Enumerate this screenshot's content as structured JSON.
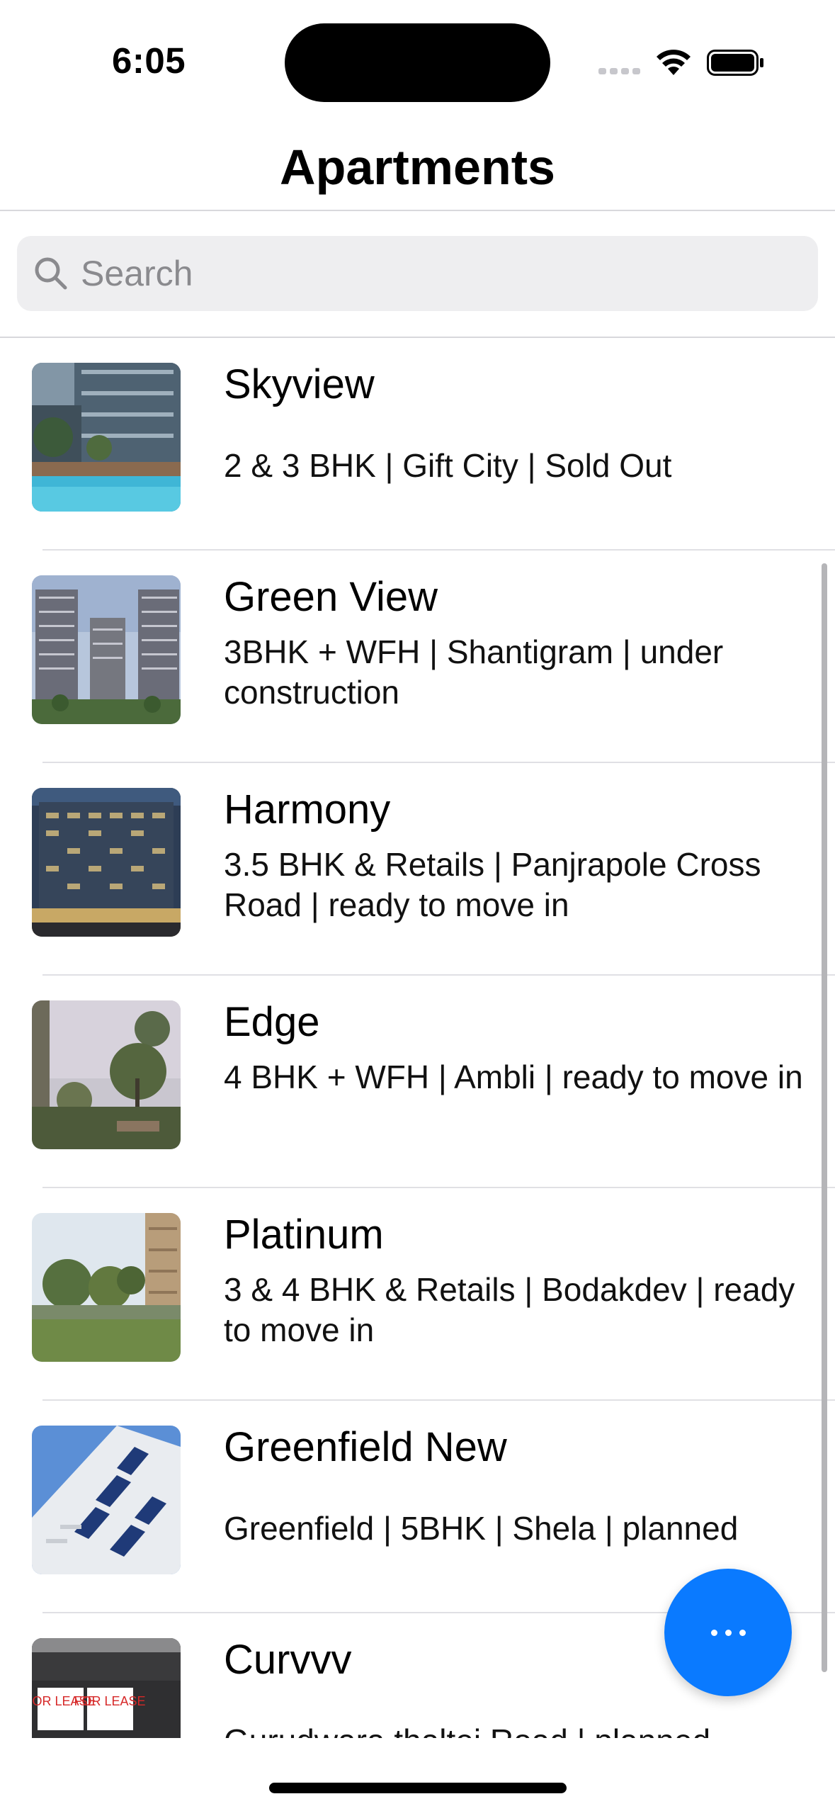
{
  "status_bar": {
    "time": "6:05"
  },
  "nav": {
    "title": "Apartments"
  },
  "search": {
    "placeholder": "Search",
    "value": ""
  },
  "apartments": [
    {
      "name": "Skyview",
      "details": "2 & 3 BHK | Gift City | Sold Out"
    },
    {
      "name": "Green View",
      "details": "3BHK + WFH | Shantigram | under construction"
    },
    {
      "name": "Harmony",
      "details": "3.5 BHK & Retails | Panjrapole Cross Road | ready to move in"
    },
    {
      "name": "Edge",
      "details": "4 BHK + WFH | Ambli | ready to move in"
    },
    {
      "name": "Platinum",
      "details": "3 & 4 BHK & Retails | Bodakdev | ready to move in"
    },
    {
      "name": "Greenfield New",
      "details": "Greenfield | 5BHK | Shela | planned"
    },
    {
      "name": "Curvvv",
      "details": "Gurudwara thaltej Road | planned",
      "thumb_sign_a": "FOR LEASE",
      "thumb_sign_b": "FOR LEASE"
    }
  ],
  "fab": {
    "icon": "ellipsis-icon",
    "color": "#0a7aff"
  }
}
